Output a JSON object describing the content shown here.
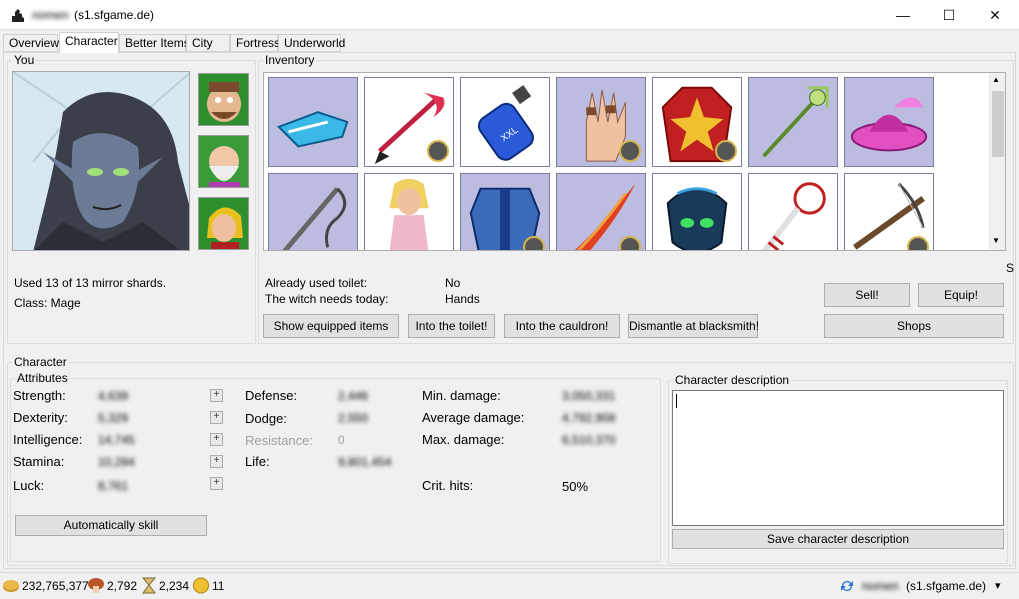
{
  "window": {
    "title": "(s1.sfgame.de)",
    "title_blurred": "nomen",
    "minimize": "—",
    "maximize": "☐",
    "close": "✕"
  },
  "tabs": [
    "Overview",
    "Character",
    "Better Items",
    "City",
    "Fortress",
    "Underworld"
  ],
  "active_tab": "Character",
  "you": {
    "group_title": "You",
    "mirror_text": "Used 13 of 13 mirror shards.",
    "class_text": "Class: Mage"
  },
  "inventory": {
    "group_title": "Inventory",
    "items": [
      {
        "icon": "blue-sandals-icon",
        "bg": "#bcbce0",
        "badge": false
      },
      {
        "icon": "red-staff-icon",
        "bg": "#ffffff",
        "badge": true
      },
      {
        "icon": "xxl-potion-icon",
        "bg": "#ffffff",
        "badge": false
      },
      {
        "icon": "ringed-hand-icon",
        "bg": "#bcbce0",
        "badge": true
      },
      {
        "icon": "red-robe-icon",
        "bg": "#ffffff",
        "badge": true
      },
      {
        "icon": "green-staff-icon",
        "bg": "#bcbce0",
        "badge": false
      },
      {
        "icon": "pink-hat-icon",
        "bg": "#bcbce0",
        "badge": false
      },
      {
        "icon": "hook-weapon-icon",
        "bg": "#bcbce0",
        "badge": false
      },
      {
        "icon": "blonde-girl-icon",
        "bg": "#ffffff",
        "badge": false
      },
      {
        "icon": "blue-armor-icon",
        "bg": "#bcbce0",
        "badge": true
      },
      {
        "icon": "flame-sword-icon",
        "bg": "#bcbce0",
        "badge": true
      },
      {
        "icon": "dark-mask-icon",
        "bg": "#ffffff",
        "badge": false
      },
      {
        "icon": "clown-key-icon",
        "bg": "#ffffff",
        "badge": false
      },
      {
        "icon": "crossbow-icon",
        "bg": "#ffffff",
        "badge": true
      }
    ],
    "truncated_label": "S"
  },
  "status": {
    "toilet_label": "Already used toilet:",
    "toilet_value": "No",
    "witch_label": "The witch needs today:",
    "witch_value": "Hands"
  },
  "buttons": {
    "show_equipped": "Show equipped items",
    "toilet": "Into the toilet!",
    "cauldron": "Into the cauldron!",
    "dismantle": "Dismantle at blacksmith!",
    "sell": "Sell!",
    "equip": "Equip!",
    "shops": "Shops",
    "auto_skill": "Automatically skill",
    "save_desc": "Save character description",
    "plus": "+"
  },
  "character": {
    "group_title": "Character",
    "attributes_title": "Attributes",
    "attributes": [
      {
        "label": "Strength:",
        "value": "4,639"
      },
      {
        "label": "Dexterity:",
        "value": "5,329"
      },
      {
        "label": "Intelligence:",
        "value": "14,745"
      },
      {
        "label": "Stamina:",
        "value": "10,284"
      },
      {
        "label": "Luck:",
        "value": "8,761"
      }
    ],
    "defense_label": "Defense:",
    "defense_value": "2,446",
    "dodge_label": "Dodge:",
    "dodge_value": "2,550",
    "resistance_label": "Resistance:",
    "resistance_value": "0",
    "life_label": "Life:",
    "life_value": "9,801,454",
    "min_dmg_label": "Min. damage:",
    "min_dmg_value": "3,050,331",
    "avg_dmg_label": "Average damage:",
    "avg_dmg_value": "4,792,908",
    "max_dmg_label": "Max. damage:",
    "max_dmg_value": "6,510,370",
    "crit_label": "Crit. hits:",
    "crit_value": "50%",
    "desc_title": "Character description"
  },
  "resources": {
    "gold": "232,765,377",
    "mushrooms": "2,792",
    "hourglasses": "2,234",
    "coins": "11",
    "server": "(s1.sfgame.de)",
    "server_blurred": "nomen",
    "dropdown": "▾"
  },
  "colors": {
    "slot_purple": "#bcbce0",
    "gold": "#d9a22a"
  }
}
